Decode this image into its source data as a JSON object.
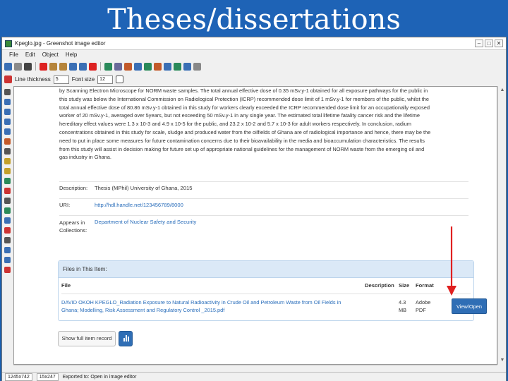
{
  "slide": {
    "title": "Theses/dissertations"
  },
  "window": {
    "title": "Kpeglo.jpg - Greenshot image editor",
    "controls": [
      "–",
      "□",
      "✕"
    ]
  },
  "menu": [
    "File",
    "Edit",
    "Object",
    "Help"
  ],
  "toolbar2": {
    "line_thickness_label": "Line thickness",
    "line_thickness_value": "5",
    "font_size_label": "Font size",
    "font_size_value": "12"
  },
  "page": {
    "abstract_lines": [
      "by Scanning Electron Microscope for NORM waste samples. The total annual effective dose of 0.35 mSv.y-1 obtained for all exposure pathways for the public in",
      "this study was below the International Commission on Radiological Protection (ICRP) recommended dose limit of 1 mSv.y-1 for members of the public, whilst the",
      "total annual effective dose of 80.86 mSv.y-1 obtained in this study for workers clearly exceeded the ICRP recommended dose limit for an occupationally exposed",
      "worker of 20 mSv.y-1, averaged over 5years, but not exceeding 50 mSv.y-1 in any single year. The estimated total lifetime fatality cancer risk and the lifetime",
      "hereditary effect values were 1.3 x 10-3 and 4.9 x 10-5 for the public, and 23.2 x 10-2 and 5.7 x 10-3 for adult workers respectively. In conclusion, radium",
      "concentrations obtained in this study for scale, sludge and produced water from the oilfields of Ghana are of radiological importance and hence, there may be the",
      "need to put in place some measures for future contamination concerns due to their bioavailability in the media and bioaccumulation characteristics. The results",
      "from this study will assist in decision making for future set up of appropriate national guidelines for the management of NORM waste from the emerging oil and",
      "gas industry in Ghana."
    ],
    "description_label": "Description:",
    "description_value": "Thesis (MPhil) University of Ghana, 2015",
    "uri_label": "URI:",
    "uri_value": "http://hdl.handle.net/123456789/8000",
    "appears_label_1": "Appears in",
    "appears_label_2": "Collections:",
    "appears_value": "Department of Nuclear Safety and Security",
    "files_header": "Files in This Item:",
    "file_cols": {
      "file": "File",
      "description": "Description",
      "size": "Size",
      "format": "Format"
    },
    "file_row": {
      "name_line1": "DAVID OKOH KPEGLO_Radiation Exposure to Natural Radioactivity in Crude Oil and Petroleum Waste from Oil Fields in",
      "name_line2": "Ghana; Modelling, Risk Assessment and Regulatory Control _2015.pdf",
      "size_line1": "4.3",
      "size_line2": "MB",
      "format_line1": "Adobe",
      "format_line2": "PDF",
      "button": "View/Open"
    },
    "full_record_button": "Show full item record"
  },
  "status": {
    "coords": "1245x742",
    "size": "15x247",
    "message": "Exported to: Open in image editor"
  },
  "colors": {
    "slide_bg": "#1e63b6",
    "link": "#2a6ebb",
    "button": "#2f6eb5",
    "arrow": "#e02020"
  }
}
